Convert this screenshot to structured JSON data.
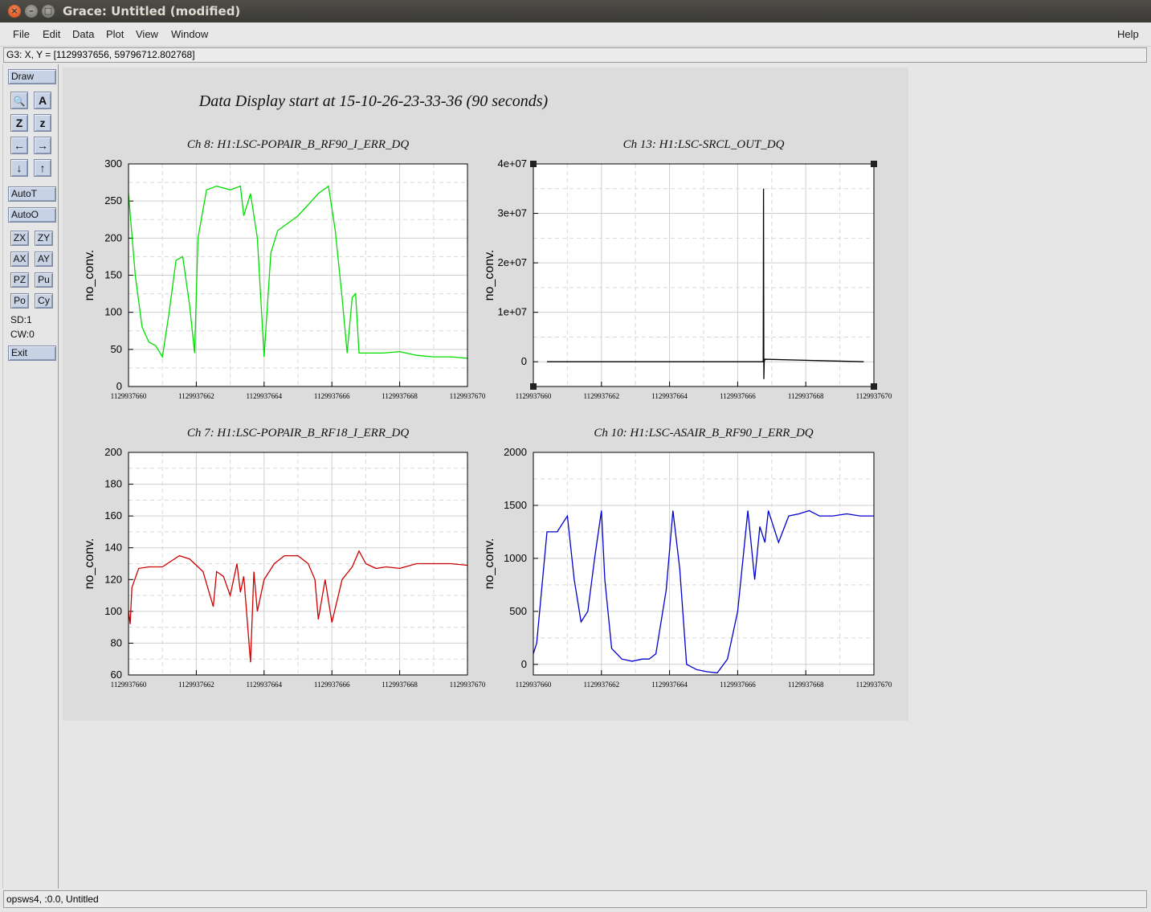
{
  "window": {
    "title": "Grace: Untitled (modified)",
    "close_glyph": "×",
    "min_glyph": "–",
    "max_glyph": "□"
  },
  "menu": {
    "items": [
      "File",
      "Edit",
      "Data",
      "Plot",
      "View",
      "Window"
    ],
    "help": "Help"
  },
  "coord_readout": "G3: X, Y = [1129937656, 59796712.802768]",
  "toolbox": {
    "draw": "Draw",
    "icons": [
      "zoom-icon",
      "text-label-icon",
      "zoom-x-icon",
      "zoom-y-icon",
      "arrow-left-icon",
      "arrow-right-icon",
      "arrow-down-icon",
      "arrow-up-icon"
    ],
    "icon_glyphs": [
      "🔍",
      "A",
      "Z",
      "z",
      "←",
      "→",
      "↓",
      "↑"
    ],
    "autot": "AutoT",
    "autoo": "AutoO",
    "small_buttons": [
      "ZX",
      "ZY",
      "AX",
      "AY",
      "PZ",
      "Pu",
      "Po",
      "Cy"
    ],
    "sd": "SD:1",
    "cw": "CW:0",
    "exit": "Exit"
  },
  "plot_title": "Data Display start at 15-10-26-23-33-36 (90 seconds)",
  "status": "opsws4, :0.0, Untitled",
  "chart_data": [
    {
      "type": "line",
      "title": "Ch 8: H1:LSC-POPAIR_B_RF90_I_ERR_DQ",
      "ylabel": "no_conv.",
      "color": "#00dd00",
      "xlim": [
        1129937660,
        1129937670
      ],
      "ylim": [
        0,
        300
      ],
      "xticks": [
        "1129937660",
        "1129937662",
        "1129937664",
        "1129937666",
        "1129937668",
        "1129937670"
      ],
      "yticks": [
        "0",
        "50",
        "100",
        "150",
        "200",
        "250",
        "300"
      ],
      "grid": true,
      "x": [
        1129937660,
        1129937660.2,
        1129937660.4,
        1129937660.6,
        1129937660.8,
        1129937661.0,
        1129937661.2,
        1129937661.4,
        1129937661.6,
        1129937661.8,
        1129937661.95,
        1129937662.05,
        1129937662.3,
        1129937662.6,
        1129937663.0,
        1129937663.3,
        1129937663.4,
        1129937663.6,
        1129937663.8,
        1129937664.0,
        1129937664.2,
        1129937664.4,
        1129937664.7,
        1129937665.0,
        1129937665.3,
        1129937665.6,
        1129937665.9,
        1129937666.1,
        1129937666.3,
        1129937666.45,
        1129937666.6,
        1129937666.7,
        1129937666.8,
        1129937667.0,
        1129937667.5,
        1129937668.0,
        1129937668.5,
        1129937669.0,
        1129937669.5,
        1129937670.0
      ],
      "y": [
        260,
        150,
        80,
        60,
        55,
        40,
        100,
        170,
        175,
        110,
        45,
        200,
        265,
        270,
        265,
        270,
        230,
        260,
        200,
        40,
        180,
        210,
        220,
        230,
        245,
        260,
        270,
        210,
        120,
        45,
        120,
        125,
        45,
        45,
        45,
        47,
        42,
        40,
        40,
        38
      ]
    },
    {
      "type": "line",
      "title": "Ch 13: H1:LSC-SRCL_OUT_DQ",
      "ylabel": "no_conv.",
      "color": "#000000",
      "xlim": [
        1129937660,
        1129937670
      ],
      "ylim": [
        -5000000,
        40000000
      ],
      "xticks": [
        "1129937660",
        "1129937662",
        "1129937664",
        "1129937666",
        "1129937668",
        "1129937670"
      ],
      "yticks": [
        "0",
        "1e+07",
        "2e+07",
        "3e+07",
        "4e+07"
      ],
      "ytick_values": [
        0,
        10000000,
        20000000,
        30000000,
        40000000
      ],
      "grid": true,
      "x": [
        1129937660.4,
        1129937666.75,
        1129937666.76,
        1129937666.77,
        1129937666.78,
        1129937666.8,
        1129937669.7
      ],
      "y": [
        0,
        0,
        35000000,
        -3500000,
        0,
        500000,
        0
      ]
    },
    {
      "type": "line",
      "title": "Ch 7: H1:LSC-POPAIR_B_RF18_I_ERR_DQ",
      "ylabel": "no_conv.",
      "color": "#cc0000",
      "xlim": [
        1129937660,
        1129937670
      ],
      "ylim": [
        60,
        200
      ],
      "xticks": [
        "1129937660",
        "1129937662",
        "1129937664",
        "1129937666",
        "1129937668",
        "1129937670"
      ],
      "yticks": [
        "60",
        "80",
        "100",
        "120",
        "140",
        "160",
        "180",
        "200"
      ],
      "grid": true,
      "x": [
        1129937660,
        1129937660.05,
        1129937660.1,
        1129937660.3,
        1129937660.6,
        1129937661.0,
        1129937661.5,
        1129937661.8,
        1129937662.2,
        1129937662.5,
        1129937662.6,
        1129937662.8,
        1129937663.0,
        1129937663.2,
        1129937663.3,
        1129937663.4,
        1129937663.5,
        1129937663.6,
        1129937663.7,
        1129937663.8,
        1129937664.0,
        1129937664.3,
        1129937664.6,
        1129937665.0,
        1129937665.3,
        1129937665.5,
        1129937665.6,
        1129937665.8,
        1129937666.0,
        1129937666.3,
        1129937666.6,
        1129937666.8,
        1129937667.0,
        1129937667.3,
        1129937667.6,
        1129937668.0,
        1129937668.5,
        1129937669.0,
        1129937669.5,
        1129937670.0
      ],
      "y": [
        100,
        92,
        115,
        127,
        128,
        128,
        135,
        133,
        125,
        103,
        125,
        122,
        110,
        130,
        112,
        122,
        95,
        68,
        125,
        100,
        120,
        130,
        135,
        135,
        130,
        120,
        95,
        120,
        93,
        120,
        128,
        138,
        130,
        127,
        128,
        127,
        130,
        130,
        130,
        129
      ]
    },
    {
      "type": "line",
      "title": "Ch 10: H1:LSC-ASAIR_B_RF90_I_ERR_DQ",
      "ylabel": "no_conv.",
      "color": "#0000cc",
      "xlim": [
        1129937660,
        1129937670
      ],
      "ylim": [
        -100,
        2000
      ],
      "xticks": [
        "1129937660",
        "1129937662",
        "1129937664",
        "1129937666",
        "1129937668",
        "1129937670"
      ],
      "yticks": [
        "0",
        "500",
        "1000",
        "1500",
        "2000"
      ],
      "ytick_values": [
        0,
        500,
        1000,
        1500,
        2000
      ],
      "grid": true,
      "x": [
        1129937660,
        1129937660.1,
        1129937660.4,
        1129937660.7,
        1129937661.0,
        1129937661.2,
        1129937661.4,
        1129937661.6,
        1129937661.8,
        1129937662.0,
        1129937662.1,
        1129937662.3,
        1129937662.6,
        1129937662.9,
        1129937663.2,
        1129937663.4,
        1129937663.6,
        1129937663.9,
        1129937664.1,
        1129937664.3,
        1129937664.5,
        1129937664.8,
        1129937665.1,
        1129937665.4,
        1129937665.7,
        1129937666.0,
        1129937666.3,
        1129937666.5,
        1129937666.65,
        1129937666.8,
        1129937666.9,
        1129937667.0,
        1129937667.2,
        1129937667.5,
        1129937667.8,
        1129937668.1,
        1129937668.4,
        1129937668.8,
        1129937669.2,
        1129937669.6,
        1129937670.0
      ],
      "y": [
        100,
        200,
        1250,
        1250,
        1400,
        800,
        400,
        500,
        1000,
        1450,
        800,
        150,
        50,
        30,
        50,
        50,
        100,
        700,
        1450,
        900,
        0,
        -50,
        -70,
        -80,
        50,
        500,
        1450,
        800,
        1300,
        1150,
        1450,
        1350,
        1150,
        1400,
        1420,
        1450,
        1400,
        1400,
        1420,
        1400,
        1400
      ]
    }
  ]
}
